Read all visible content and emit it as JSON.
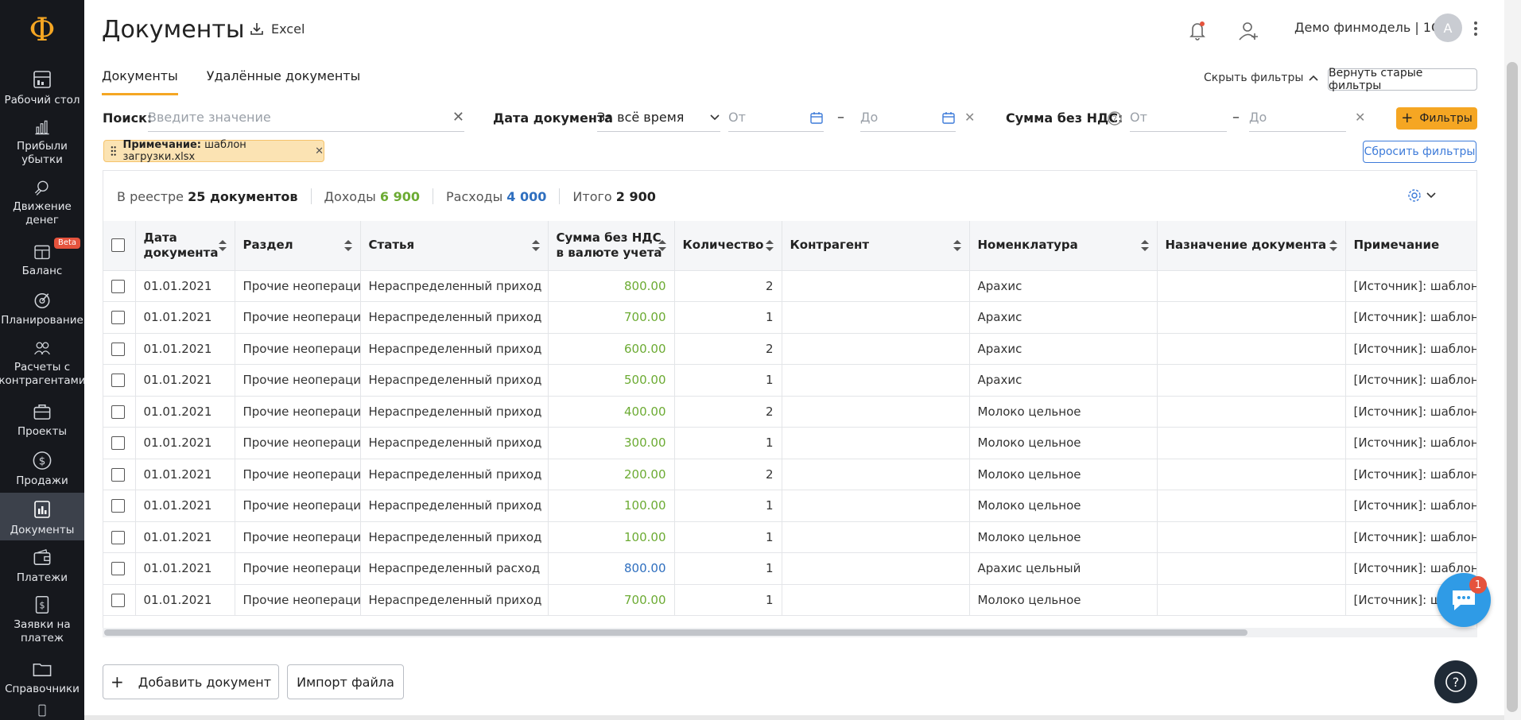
{
  "sidebar": {
    "logo": "Ф",
    "items": [
      {
        "label": "Рабочий стол",
        "icon": "desk-icon"
      },
      {
        "label": "Прибыли убытки",
        "icon": "chart-icon"
      },
      {
        "label": "Движение денег",
        "icon": "money-flow-icon"
      },
      {
        "label": "Баланс",
        "icon": "balance-icon",
        "badge": "Beta"
      },
      {
        "label": "Планирование",
        "icon": "planning-icon"
      },
      {
        "label": "Расчеты с контрагентами",
        "icon": "contractors-icon"
      },
      {
        "label": "Проекты",
        "icon": "briefcase-icon"
      },
      {
        "label": "Продажи",
        "icon": "dollar-icon"
      },
      {
        "label": "Документы",
        "icon": "documents-icon",
        "active": true
      },
      {
        "label": "Платежи",
        "icon": "wallet-icon"
      },
      {
        "label": "Заявки на платеж",
        "icon": "payment-request-icon"
      },
      {
        "label": "Справочники",
        "icon": "folder-icon"
      }
    ]
  },
  "header": {
    "title": "Документы",
    "excel_label": "Excel",
    "company": "Демо финмодель | 1С",
    "avatar_letter": "А"
  },
  "tabs": [
    {
      "label": "Документы",
      "active": true
    },
    {
      "label": "Удалённые документы",
      "active": false
    }
  ],
  "filters": {
    "hide_filters_label": "Скрыть фильтры",
    "old_filters_label": "Вернуть старые фильтры",
    "search_label": "Поиск:",
    "search_placeholder": "Введите значение",
    "date_label": "Дата документа",
    "date_period": "За всё время",
    "from_placeholder": "От",
    "to_placeholder": "До",
    "sum_label": "Сумма без НДС:",
    "filters_button": "Фильтры",
    "chip_label": "Примечание:",
    "chip_value": "шаблон загрузки.xlsx",
    "reset_label": "Сбросить фильтры"
  },
  "summary": {
    "registry_label": "В реестре",
    "registry_value": "25 документов",
    "income_label": "Доходы",
    "income_value": "6 900",
    "expense_label": "Расходы",
    "expense_value": "4 000",
    "total_label": "Итого",
    "total_value": "2 900"
  },
  "table": {
    "columns": [
      "Дата документа",
      "Раздел",
      "Статья",
      "Сумма без НДС в валюте учета",
      "Количество",
      "Контрагент",
      "Номенклатура",
      "Назначение документа",
      "Примечание"
    ],
    "rows": [
      {
        "date": "01.01.2021",
        "section": "Прочие неоперацио",
        "article": "Нераспределенный приход",
        "sum": "800.00",
        "type": "income",
        "qty": "2",
        "contractor": "",
        "item": "Арахис",
        "purpose": "",
        "note": "[Источник]: шаблон загр"
      },
      {
        "date": "01.01.2021",
        "section": "Прочие неоперацио",
        "article": "Нераспределенный приход",
        "sum": "700.00",
        "type": "income",
        "qty": "1",
        "contractor": "",
        "item": "Арахис",
        "purpose": "",
        "note": "[Источник]: шаблон загр"
      },
      {
        "date": "01.01.2021",
        "section": "Прочие неоперацио",
        "article": "Нераспределенный приход",
        "sum": "600.00",
        "type": "income",
        "qty": "2",
        "contractor": "",
        "item": "Арахис",
        "purpose": "",
        "note": "[Источник]: шаблон загр"
      },
      {
        "date": "01.01.2021",
        "section": "Прочие неоперацио",
        "article": "Нераспределенный приход",
        "sum": "500.00",
        "type": "income",
        "qty": "1",
        "contractor": "",
        "item": "Арахис",
        "purpose": "",
        "note": "[Источник]: шаблон загр"
      },
      {
        "date": "01.01.2021",
        "section": "Прочие неоперацио",
        "article": "Нераспределенный приход",
        "sum": "400.00",
        "type": "income",
        "qty": "2",
        "contractor": "",
        "item": "Молоко цельное",
        "purpose": "",
        "note": "[Источник]: шаблон загр"
      },
      {
        "date": "01.01.2021",
        "section": "Прочие неоперацио",
        "article": "Нераспределенный приход",
        "sum": "300.00",
        "type": "income",
        "qty": "1",
        "contractor": "",
        "item": "Молоко цельное",
        "purpose": "",
        "note": "[Источник]: шаблон загр"
      },
      {
        "date": "01.01.2021",
        "section": "Прочие неоперацио",
        "article": "Нераспределенный приход",
        "sum": "200.00",
        "type": "income",
        "qty": "2",
        "contractor": "",
        "item": "Молоко цельное",
        "purpose": "",
        "note": "[Источник]: шаблон загр"
      },
      {
        "date": "01.01.2021",
        "section": "Прочие неоперацио",
        "article": "Нераспределенный приход",
        "sum": "100.00",
        "type": "income",
        "qty": "1",
        "contractor": "",
        "item": "Молоко цельное",
        "purpose": "",
        "note": "[Источник]: шаблон загр"
      },
      {
        "date": "01.01.2021",
        "section": "Прочие неоперацио",
        "article": "Нераспределенный приход",
        "sum": "100.00",
        "type": "income",
        "qty": "1",
        "contractor": "",
        "item": "Молоко цельное",
        "purpose": "",
        "note": "[Источник]: шаблон загр"
      },
      {
        "date": "01.01.2021",
        "section": "Прочие неоперацио",
        "article": "Нераспределенный расход",
        "sum": "800.00",
        "type": "expense",
        "qty": "1",
        "contractor": "",
        "item": "Арахис цельный",
        "purpose": "",
        "note": "[Источник]: шаблон загр"
      },
      {
        "date": "01.01.2021",
        "section": "Прочие неоперацио",
        "article": "Нераспределенный приход",
        "sum": "700.00",
        "type": "income",
        "qty": "1",
        "contractor": "",
        "item": "Молоко цельное",
        "purpose": "",
        "note": "[Источник]: шабл"
      }
    ]
  },
  "buttons": {
    "add_document": "Добавить документ",
    "import_file": "Импорт файла"
  },
  "chat": {
    "badge": "1"
  },
  "colors": {
    "accent": "#f5a623",
    "income": "#6cab33",
    "expense": "#2f6fbf",
    "sidebar": "#16181d"
  }
}
